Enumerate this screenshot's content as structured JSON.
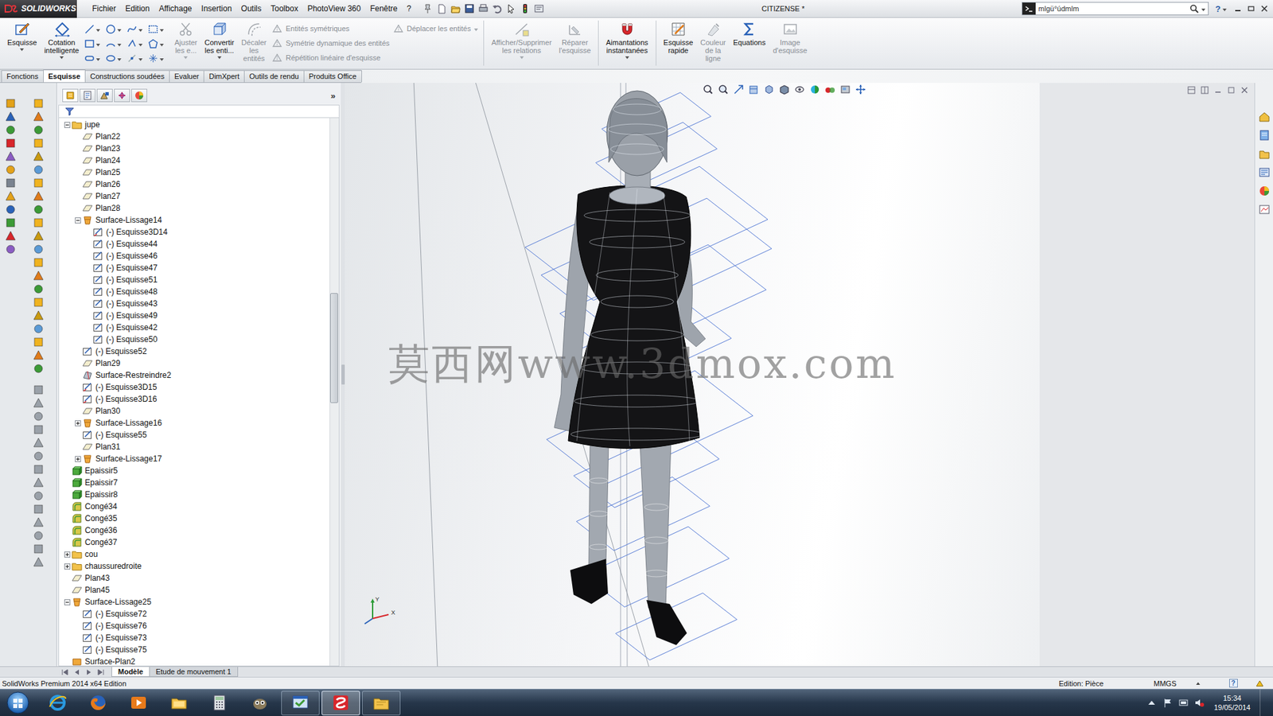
{
  "titlebar": {
    "logo": "SOLIDWORKS",
    "menus": [
      "Fichier",
      "Edition",
      "Affichage",
      "Insertion",
      "Outils",
      "Toolbox",
      "PhotoView 360",
      "Fenêtre",
      "?"
    ],
    "document": "CITIZENSE *",
    "search": {
      "value": "mlgü°údmlm"
    },
    "help": "?"
  },
  "ribbon": [
    {
      "kind": "large",
      "lines": [
        "Esquisse"
      ],
      "disabled": false,
      "dropdown": true
    },
    {
      "kind": "large",
      "lines": [
        "Cotation",
        "intelligente"
      ],
      "disabled": false,
      "dropdown": true
    },
    {
      "kind": "grid"
    },
    {
      "kind": "large",
      "lines": [
        "Ajuster",
        "les e..."
      ],
      "disabled": true,
      "dropdown": true
    },
    {
      "kind": "large",
      "lines": [
        "Convertir",
        "les enti..."
      ],
      "disabled": false,
      "dropdown": true
    },
    {
      "kind": "large",
      "lines": [
        "Décaler",
        "les",
        "entités"
      ],
      "disabled": true,
      "dropdown": false
    },
    {
      "kind": "stack",
      "rows": [
        {
          "label": "Entités symétriques",
          "disabled": true
        },
        {
          "label": "Symétrie dynamique des entités",
          "disabled": true
        },
        {
          "label": "Répétition linéaire d'esquisse",
          "disabled": true
        }
      ]
    },
    {
      "kind": "stack",
      "rows": [
        {
          "label": "Déplacer les entités",
          "disabled": true
        }
      ]
    },
    {
      "kind": "separator"
    },
    {
      "kind": "large",
      "lines": [
        "Afficher/Supprimer",
        "les relations"
      ],
      "disabled": true,
      "dropdown": true
    },
    {
      "kind": "large",
      "lines": [
        "Réparer",
        "l'esquisse"
      ],
      "disabled": true,
      "dropdown": false
    },
    {
      "kind": "separator"
    },
    {
      "kind": "large",
      "lines": [
        "Aimantations",
        "instantanées"
      ],
      "disabled": false,
      "dropdown": true
    },
    {
      "kind": "separator"
    },
    {
      "kind": "large",
      "lines": [
        "Esquisse",
        "rapide"
      ],
      "disabled": false,
      "dropdown": false
    },
    {
      "kind": "large",
      "lines": [
        "Couleur",
        "de la",
        "ligne"
      ],
      "disabled": true,
      "dropdown": false
    },
    {
      "kind": "large",
      "lines": [
        "Equations"
      ],
      "disabled": false,
      "dropdown": false
    },
    {
      "kind": "large",
      "lines": [
        "Image",
        "d'esquisse"
      ],
      "disabled": true,
      "dropdown": false
    }
  ],
  "command_tabs": [
    {
      "label": "Fonctions",
      "selected": false
    },
    {
      "label": "Esquisse",
      "selected": true
    },
    {
      "label": "Constructions soudées",
      "selected": false
    },
    {
      "label": "Evaluer",
      "selected": false
    },
    {
      "label": "DimXpert",
      "selected": false
    },
    {
      "label": "Outils de rendu",
      "selected": false
    },
    {
      "label": "Produits Office",
      "selected": false
    }
  ],
  "feature_tree": {
    "collapse": "»",
    "scrollbar": {
      "offset": 0.32,
      "level": 0.2
    },
    "items": [
      {
        "label": "jupe",
        "level": 0,
        "kind": "folder",
        "expandable": true,
        "expanded": true
      },
      {
        "label": "Plan22",
        "level": 1,
        "kind": "plane",
        "expandable": false,
        "expanded": false
      },
      {
        "label": "Plan23",
        "level": 1,
        "kind": "plane",
        "expandable": false,
        "expanded": false
      },
      {
        "label": "Plan24",
        "level": 1,
        "kind": "plane",
        "expandable": false,
        "expanded": false
      },
      {
        "label": "Plan25",
        "level": 1,
        "kind": "plane",
        "expandable": false,
        "expanded": false
      },
      {
        "label": "Plan26",
        "level": 1,
        "kind": "plane",
        "expandable": false,
        "expanded": false
      },
      {
        "label": "Plan27",
        "level": 1,
        "kind": "plane",
        "expandable": false,
        "expanded": false
      },
      {
        "label": "Plan28",
        "level": 1,
        "kind": "plane",
        "expandable": false,
        "expanded": false
      },
      {
        "label": "Surface-Lissage14",
        "level": 1,
        "kind": "loft",
        "expandable": true,
        "expanded": true
      },
      {
        "label": "(-) Esquisse3D14",
        "level": 2,
        "kind": "sketch3d",
        "expandable": false,
        "expanded": false
      },
      {
        "label": "(-) Esquisse44",
        "level": 2,
        "kind": "sketch",
        "expandable": false,
        "expanded": false
      },
      {
        "label": "(-) Esquisse46",
        "level": 2,
        "kind": "sketch",
        "expandable": false,
        "expanded": false
      },
      {
        "label": "(-) Esquisse47",
        "level": 2,
        "kind": "sketch",
        "expandable": false,
        "expanded": false
      },
      {
        "label": "(-) Esquisse51",
        "level": 2,
        "kind": "sketch",
        "expandable": false,
        "expanded": false
      },
      {
        "label": "(-) Esquisse48",
        "level": 2,
        "kind": "sketch",
        "expandable": false,
        "expanded": false
      },
      {
        "label": "(-) Esquisse43",
        "level": 2,
        "kind": "sketch",
        "expandable": false,
        "expanded": false
      },
      {
        "label": "(-) Esquisse49",
        "level": 2,
        "kind": "sketch",
        "expandable": false,
        "expanded": false
      },
      {
        "label": "(-) Esquisse42",
        "level": 2,
        "kind": "sketch",
        "expandable": false,
        "expanded": false
      },
      {
        "label": "(-) Esquisse50",
        "level": 2,
        "kind": "sketch",
        "expandable": false,
        "expanded": false
      },
      {
        "label": "(-) Esquisse52",
        "level": 1,
        "kind": "sketch",
        "expandable": false,
        "expanded": false
      },
      {
        "label": "Plan29",
        "level": 1,
        "kind": "plane",
        "expandable": false,
        "expanded": false
      },
      {
        "label": "Surface-Restreindre2",
        "level": 1,
        "kind": "trim",
        "expandable": false,
        "expanded": false
      },
      {
        "label": "(-) Esquisse3D15",
        "level": 1,
        "kind": "sketch3d",
        "expandable": false,
        "expanded": false
      },
      {
        "label": "(-) Esquisse3D16",
        "level": 1,
        "kind": "sketch3d",
        "expandable": false,
        "expanded": false
      },
      {
        "label": "Plan30",
        "level": 1,
        "kind": "plane",
        "expandable": false,
        "expanded": false
      },
      {
        "label": "Surface-Lissage16",
        "level": 1,
        "kind": "loft",
        "expandable": true,
        "expanded": false
      },
      {
        "label": "(-) Esquisse55",
        "level": 1,
        "kind": "sketch",
        "expandable": false,
        "expanded": false
      },
      {
        "label": "Plan31",
        "level": 1,
        "kind": "plane",
        "expandable": false,
        "expanded": false
      },
      {
        "label": "Surface-Lissage17",
        "level": 1,
        "kind": "loft",
        "expandable": true,
        "expanded": false
      },
      {
        "label": "Epaissir5",
        "level": 0,
        "kind": "thicken",
        "expandable": false,
        "expanded": false
      },
      {
        "label": "Epaissir7",
        "level": 0,
        "kind": "thicken",
        "expandable": false,
        "expanded": false
      },
      {
        "label": "Epaissir8",
        "level": 0,
        "kind": "thicken",
        "expandable": false,
        "expanded": false
      },
      {
        "label": "Congé34",
        "level": 0,
        "kind": "fillet",
        "expandable": false,
        "expanded": false
      },
      {
        "label": "Congé35",
        "level": 0,
        "kind": "fillet",
        "expandable": false,
        "expanded": false
      },
      {
        "label": "Congé36",
        "level": 0,
        "kind": "fillet",
        "expandable": false,
        "expanded": false
      },
      {
        "label": "Congé37",
        "level": 0,
        "kind": "fillet",
        "expandable": false,
        "expanded": false
      },
      {
        "label": "cou",
        "level": 0,
        "kind": "folder",
        "expandable": true,
        "expanded": false
      },
      {
        "label": "chaussuredroite",
        "level": 0,
        "kind": "folder",
        "expandable": true,
        "expanded": false
      },
      {
        "label": "Plan43",
        "level": 0,
        "kind": "plane",
        "expandable": false,
        "expanded": false
      },
      {
        "label": "Plan45",
        "level": 0,
        "kind": "plane",
        "expandable": false,
        "expanded": false
      },
      {
        "label": "Surface-Lissage25",
        "level": 0,
        "kind": "loft",
        "expandable": true,
        "expanded": true
      },
      {
        "label": "(-) Esquisse72",
        "level": 1,
        "kind": "sketch",
        "expandable": false,
        "expanded": false
      },
      {
        "label": "(-) Esquisse76",
        "level": 1,
        "kind": "sketch",
        "expandable": false,
        "expanded": false
      },
      {
        "label": "(-) Esquisse73",
        "level": 1,
        "kind": "sketch",
        "expandable": false,
        "expanded": false
      },
      {
        "label": "(-) Esquisse75",
        "level": 1,
        "kind": "sketch",
        "expandable": false,
        "expanded": false
      },
      {
        "label": "Surface-Plan2",
        "level": 0,
        "kind": "surface",
        "expandable": false,
        "expanded": false
      }
    ]
  },
  "viewport": {
    "watermark": "莫西网www.3dmox.com",
    "triad": [
      "Y",
      "X"
    ]
  },
  "bottom_tabs": [
    {
      "label": "Modèle",
      "selected": true
    },
    {
      "label": "Etude de mouvement 1",
      "selected": false
    }
  ],
  "status_bar": {
    "product": "SolidWorks Premium 2014 x64 Edition",
    "mode": "Edition: Pièce",
    "units": "MMGS",
    "help": "?"
  },
  "taskbar": {
    "apps": [
      {
        "kind": "ie",
        "running": false,
        "active": false
      },
      {
        "kind": "firefox",
        "running": false,
        "active": false
      },
      {
        "kind": "media",
        "running": false,
        "active": false
      },
      {
        "kind": "explorer",
        "running": false,
        "active": false
      },
      {
        "kind": "calculator",
        "running": false,
        "active": false
      },
      {
        "kind": "gimp",
        "running": false,
        "active": false
      },
      {
        "kind": "program",
        "running": true,
        "active": false
      },
      {
        "kind": "solidworks",
        "running": true,
        "active": true
      },
      {
        "kind": "folder",
        "running": true,
        "active": false
      }
    ],
    "time": "15:34",
    "date": "19/05/2014"
  }
}
